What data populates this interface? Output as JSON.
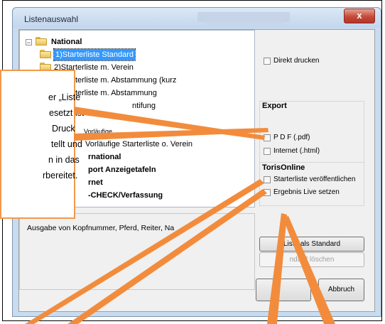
{
  "window": {
    "title": "Listenauswahl",
    "close_glyph": "x",
    "accent_color": "#3399ff",
    "annotation_color": "#f28c3c"
  },
  "tree": {
    "root_expander": "−",
    "items": [
      {
        "label": "National"
      },
      {
        "label": "1)Starterliste Standard"
      },
      {
        "label": "2)Starterliste m. Verein"
      },
      {
        "label": "3)Starterliste m. Abstammung (kurz"
      },
      {
        "label": "4)Starterliste m. Abstammung"
      },
      {
        "label": "ntifung"
      },
      {
        "label": "Vorläufige"
      },
      {
        "label": "Vorläufige Starterliste o. Verein"
      },
      {
        "label": "rnational"
      },
      {
        "label": "port Anzeigetafeln"
      },
      {
        "label": "rnet"
      },
      {
        "label": "-CHECK/Verfassung"
      }
    ]
  },
  "options": {
    "direkt_drucken": "Direkt drucken",
    "export_title": "Export",
    "pdf": "P D F  (.pdf)",
    "internet": "Internet (.html)",
    "toris_title": "TorisOnline",
    "starterliste_veroeffentlichen": "Starterliste veröffentlichen",
    "ergebnis_live": "Ergebnis Live setzen"
  },
  "description": "Ausgabe von Kopfnummer, Pferd, Reiter, Na",
  "buttons": {
    "liste_als_standard": "Liste als Standard",
    "standard_loeschen": "ndard löschen",
    "abbruch": "Abbruch"
  },
  "callout": {
    "lines": [
      "er „Liste",
      "esetzt ist",
      "Druck",
      "tellt und",
      "n in das",
      "rbereitet."
    ]
  }
}
